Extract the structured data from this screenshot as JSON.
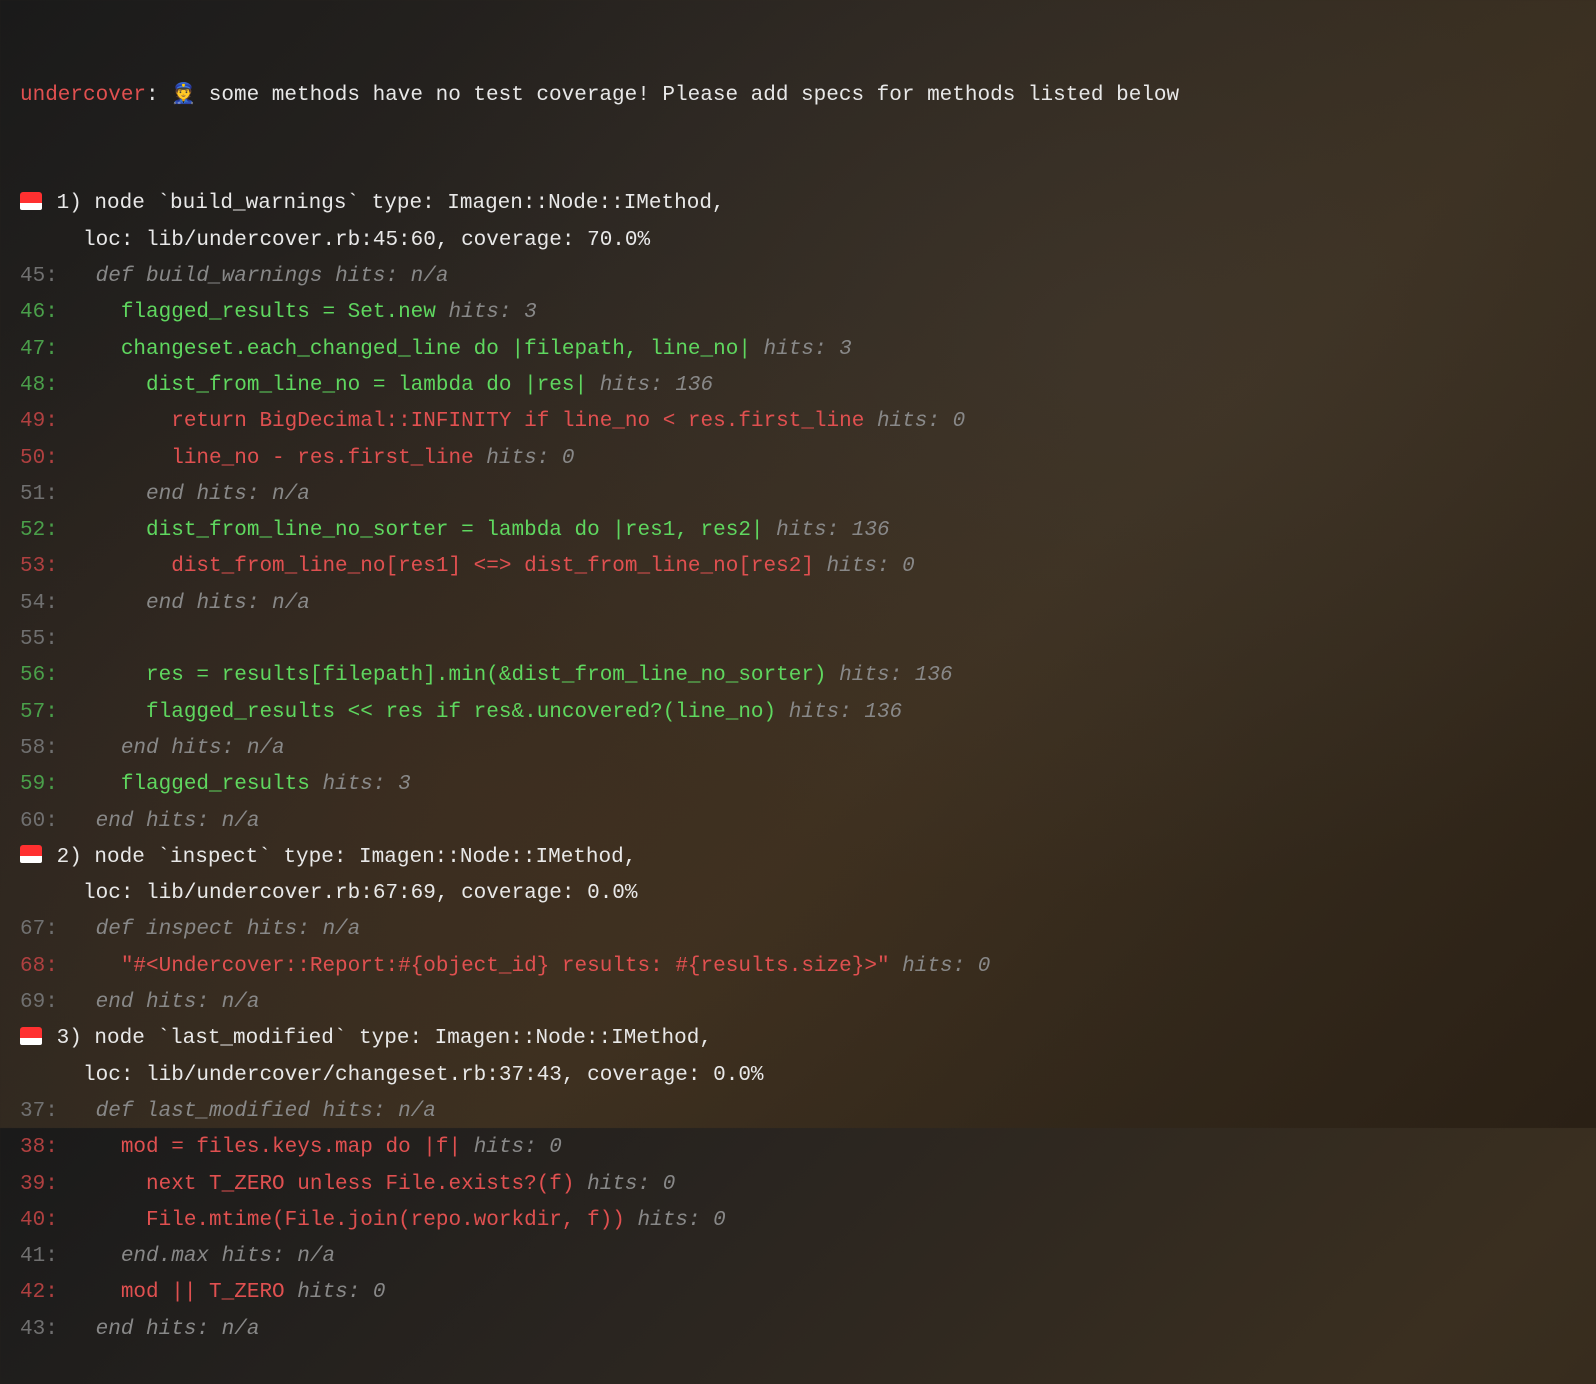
{
  "header": {
    "prefix": "undercover",
    "emoji": "👮",
    "message": " some methods have no test coverage! Please add specs for methods listed below"
  },
  "nodes": [
    {
      "idx": "1)",
      "header1": " node `build_warnings` type: Imagen::Node::IMethod,",
      "header2": "     loc: lib/undercover.rb:45:60, coverage: 70.0%",
      "lines": [
        {
          "ln": "45:",
          "lnc": "ln-dim",
          "body": "   def build_warnings ",
          "bc": "dim",
          "hits": "hits: n/a",
          "hc": "dim"
        },
        {
          "ln": "46:",
          "lnc": "ln-green",
          "body": "     flagged_results = Set.new ",
          "bc": "green",
          "hits": "hits: 3",
          "hc": "dim"
        },
        {
          "ln": "47:",
          "lnc": "ln-green",
          "body": "     changeset.each_changed_line do |filepath, line_no| ",
          "bc": "green",
          "hits": "hits: 3",
          "hc": "dim"
        },
        {
          "ln": "48:",
          "lnc": "ln-green",
          "body": "       dist_from_line_no = lambda do |res| ",
          "bc": "green",
          "hits": "hits: 136",
          "hc": "dim"
        },
        {
          "ln": "49:",
          "lnc": "ln-red",
          "body": "         return BigDecimal::INFINITY if line_no < res.first_line ",
          "bc": "red",
          "hits": "hits: 0",
          "hc": "dim"
        },
        {
          "ln": "50:",
          "lnc": "ln-red",
          "body": "         line_no - res.first_line ",
          "bc": "red",
          "hits": "hits: 0",
          "hc": "dim"
        },
        {
          "ln": "51:",
          "lnc": "ln-dim",
          "body": "       end ",
          "bc": "dim",
          "hits": "hits: n/a",
          "hc": "dim"
        },
        {
          "ln": "52:",
          "lnc": "ln-green",
          "body": "       dist_from_line_no_sorter = lambda do |res1, res2| ",
          "bc": "green",
          "hits": "hits: 136",
          "hc": "dim"
        },
        {
          "ln": "53:",
          "lnc": "ln-red",
          "body": "         dist_from_line_no[res1] <=> dist_from_line_no[res2] ",
          "bc": "red",
          "hits": "hits: 0",
          "hc": "dim"
        },
        {
          "ln": "54:",
          "lnc": "ln-dim",
          "body": "       end ",
          "bc": "dim",
          "hits": "hits: n/a",
          "hc": "dim"
        },
        {
          "ln": "55:",
          "lnc": "ln-dim",
          "body": "",
          "bc": "dim",
          "hits": "",
          "hc": "dim"
        },
        {
          "ln": "56:",
          "lnc": "ln-green",
          "body": "       res = results[filepath].min(&dist_from_line_no_sorter) ",
          "bc": "green",
          "hits": "hits: 136",
          "hc": "dim"
        },
        {
          "ln": "57:",
          "lnc": "ln-green",
          "body": "       flagged_results << res if res&.uncovered?(line_no) ",
          "bc": "green",
          "hits": "hits: 136",
          "hc": "dim"
        },
        {
          "ln": "58:",
          "lnc": "ln-dim",
          "body": "     end ",
          "bc": "dim",
          "hits": "hits: n/a",
          "hc": "dim"
        },
        {
          "ln": "59:",
          "lnc": "ln-green",
          "body": "     flagged_results ",
          "bc": "green",
          "hits": "hits: 3",
          "hc": "dim"
        },
        {
          "ln": "60:",
          "lnc": "ln-dim",
          "body": "   end ",
          "bc": "dim",
          "hits": "hits: n/a",
          "hc": "dim"
        }
      ]
    },
    {
      "idx": "2)",
      "header1": " node `inspect` type: Imagen::Node::IMethod,",
      "header2": "     loc: lib/undercover.rb:67:69, coverage: 0.0%",
      "lines": [
        {
          "ln": "67:",
          "lnc": "ln-dim",
          "body": "   def inspect ",
          "bc": "dim",
          "hits": "hits: n/a",
          "hc": "dim"
        },
        {
          "ln": "68:",
          "lnc": "ln-red",
          "body": "     \"#<Undercover::Report:#{object_id} results: #{results.size}>\" ",
          "bc": "red",
          "hits": "hits: 0",
          "hc": "dim"
        },
        {
          "ln": "69:",
          "lnc": "ln-dim",
          "body": "   end ",
          "bc": "dim",
          "hits": "hits: n/a",
          "hc": "dim"
        }
      ]
    },
    {
      "idx": "3)",
      "header1": " node `last_modified` type: Imagen::Node::IMethod,",
      "header2": "     loc: lib/undercover/changeset.rb:37:43, coverage: 0.0%",
      "lines": [
        {
          "ln": "37:",
          "lnc": "ln-dim",
          "body": "   def last_modified ",
          "bc": "dim",
          "hits": "hits: n/a",
          "hc": "dim"
        },
        {
          "ln": "38:",
          "lnc": "ln-red",
          "body": "     mod = files.keys.map do |f| ",
          "bc": "red",
          "hits": "hits: 0",
          "hc": "dim"
        },
        {
          "ln": "39:",
          "lnc": "ln-red",
          "body": "       next T_ZERO unless File.exists?(f) ",
          "bc": "red",
          "hits": "hits: 0",
          "hc": "dim"
        },
        {
          "ln": "40:",
          "lnc": "ln-red",
          "body": "       File.mtime(File.join(repo.workdir, f)) ",
          "bc": "red",
          "hits": "hits: 0",
          "hc": "dim"
        },
        {
          "ln": "41:",
          "lnc": "ln-dim",
          "body": "     end.max ",
          "bc": "dim",
          "hits": "hits: n/a",
          "hc": "dim"
        },
        {
          "ln": "42:",
          "lnc": "ln-red",
          "body": "     mod || T_ZERO ",
          "bc": "red",
          "hits": "hits: 0",
          "hc": "dim"
        },
        {
          "ln": "43:",
          "lnc": "ln-dim",
          "body": "   end ",
          "bc": "dim",
          "hits": "hits: n/a",
          "hc": "dim"
        }
      ]
    }
  ]
}
